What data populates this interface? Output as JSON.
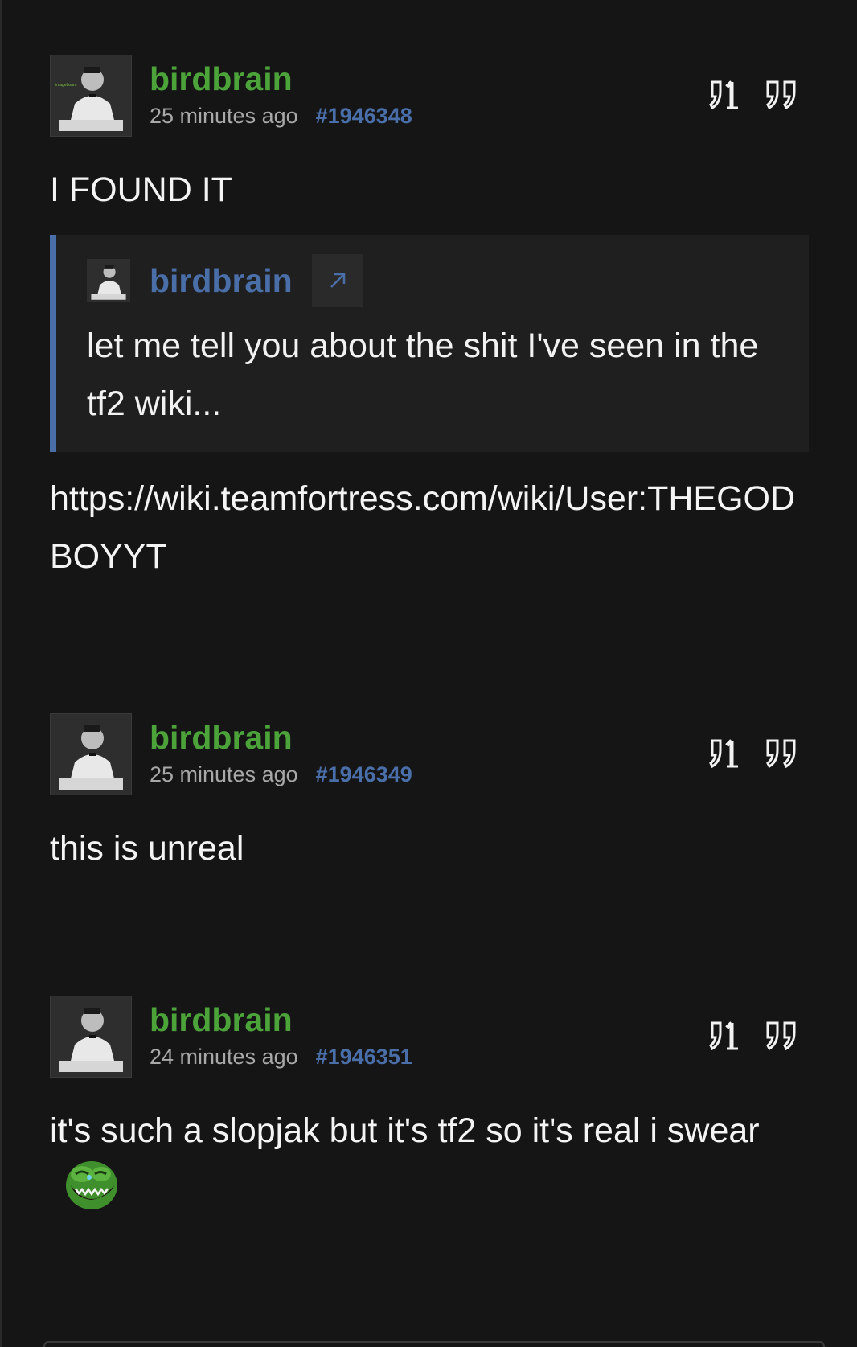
{
  "posts": [
    {
      "author": "birdbrain",
      "time": "25 minutes ago",
      "post_number": "#1946348",
      "body_before_quote": "I FOUND IT",
      "quote": {
        "author": "birdbrain",
        "text": "let me tell you about the shit I've seen in the tf2 wiki..."
      },
      "body_after_quote": "https://wiki.teamfortress.com/wiki/User:THEGODBOYYT"
    },
    {
      "author": "birdbrain",
      "time": "25 minutes ago",
      "post_number": "#1946349",
      "body": "this is unreal"
    },
    {
      "author": "birdbrain",
      "time": "24 minutes ago",
      "post_number": "#1946351",
      "body": "it's such a slopjak but it's tf2 so it's real i swear",
      "emoji": "laughing-frog-emoji"
    }
  ],
  "icons": {
    "reply": "reply-number-icon",
    "quote": "quote-icon",
    "jump": "arrow-up-right-icon"
  },
  "colors": {
    "background": "#151516",
    "author": "#4ba33a",
    "link": "#4a6ea8",
    "quote_bg": "#1f1f20",
    "muted": "#a8a8a8"
  }
}
